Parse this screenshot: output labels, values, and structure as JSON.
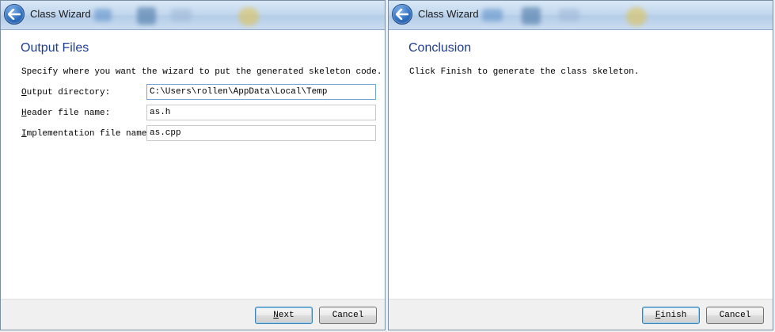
{
  "left_window": {
    "title": "Class Wizard",
    "heading": "Output Files",
    "instruction": "Specify where you want the wizard to put the generated skeleton code.",
    "fields": [
      {
        "label_mnemonic": "O",
        "label_rest": "utput directory:",
        "value": "C:\\Users\\rollen\\AppData\\Local\\Temp"
      },
      {
        "label_mnemonic": "H",
        "label_rest": "eader file name:",
        "value": "as.h"
      },
      {
        "label_mnemonic": "I",
        "label_rest": "mplementation file name:",
        "value": "as.cpp"
      }
    ],
    "buttons": {
      "next_mnemonic": "N",
      "next_rest": "ext",
      "cancel_label": "Cancel"
    }
  },
  "right_window": {
    "title": "Class Wizard",
    "heading": "Conclusion",
    "instruction": "Click Finish to generate the class skeleton.",
    "buttons": {
      "finish_mnemonic": "F",
      "finish_rest": "inish",
      "cancel_label": "Cancel"
    }
  },
  "icons": {
    "back": "back-arrow-icon"
  },
  "colors": {
    "heading": "#1e3d8f",
    "titlebar": "#c3d8ee",
    "back_button": "#2f6fc0",
    "default_button_border": "#3c7fb1"
  }
}
